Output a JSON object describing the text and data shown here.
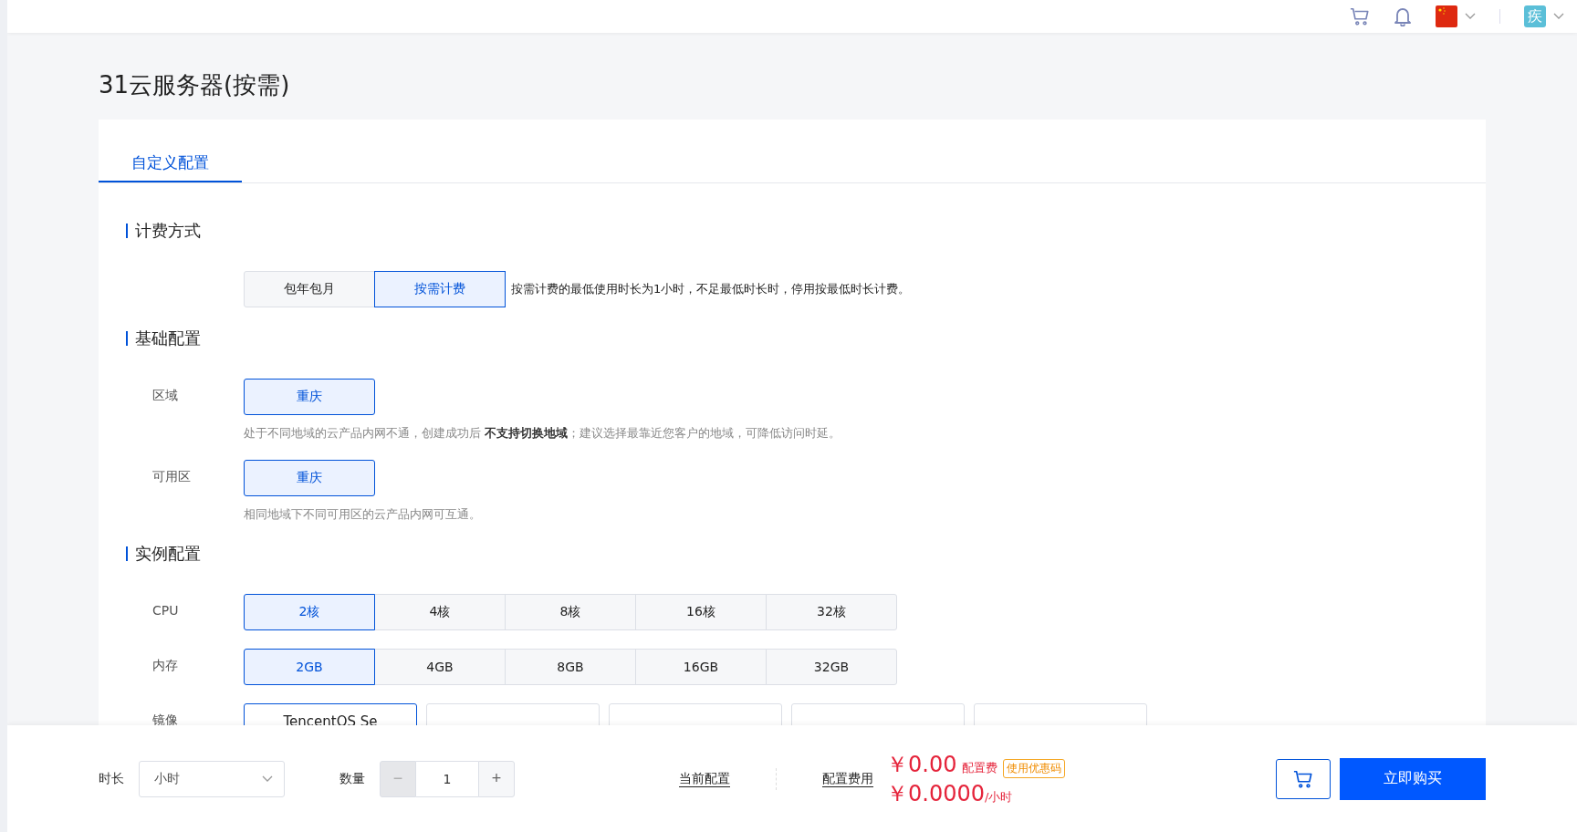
{
  "header": {
    "avatar_text": "疾"
  },
  "page_title": "31云服务器(按需)",
  "tabs": [
    {
      "label": "自定义配置",
      "selected": true
    }
  ],
  "sections": [
    {
      "heading": "计费方式",
      "fields": [
        {
          "kind": "segmented",
          "options": [
            {
              "label": "包年包月",
              "selected": false
            },
            {
              "label": "按需计费",
              "selected": true
            }
          ],
          "note": "按需计费的最低使用时长为1小时，不足最低时长时，停用按最低时长计费。"
        }
      ]
    },
    {
      "heading": "基础配置",
      "fields": [
        {
          "kind": "segmented",
          "label": "区域",
          "options": [
            {
              "label": "重庆",
              "selected": true
            }
          ],
          "hint": "处于不同地域的云产品内网不通，创建成功后 **不支持切换地域**；建议选择最靠近您客户的地域，可降低访问时延。"
        },
        {
          "kind": "segmented",
          "label": "可用区",
          "options": [
            {
              "label": "重庆",
              "selected": true
            }
          ],
          "hint": "相同地域下不同可用区的云产品内网可互通。"
        }
      ]
    },
    {
      "heading": "实例配置",
      "fields": [
        {
          "kind": "segmented",
          "label": "CPU",
          "options": [
            {
              "label": "2核",
              "selected": true
            },
            {
              "label": "4核",
              "selected": false
            },
            {
              "label": "8核",
              "selected": false
            },
            {
              "label": "16核",
              "selected": false
            },
            {
              "label": "32核",
              "selected": false
            }
          ]
        },
        {
          "kind": "segmented",
          "label": "内存",
          "options": [
            {
              "label": "2GB",
              "selected": true
            },
            {
              "label": "4GB",
              "selected": false
            },
            {
              "label": "8GB",
              "selected": false
            },
            {
              "label": "16GB",
              "selected": false
            },
            {
              "label": "32GB",
              "selected": false
            }
          ]
        },
        {
          "kind": "cards",
          "label": "镜像",
          "options": [
            {
              "label": "TencentOS Se",
              "selected": true
            },
            {
              "selected": false
            },
            {
              "selected": false
            },
            {
              "selected": false
            },
            {
              "selected": false
            }
          ]
        }
      ]
    }
  ],
  "bottom_bar": {
    "duration": {
      "label": "时长",
      "value": "小时"
    },
    "quantity": {
      "label": "数量",
      "value": "1",
      "decrement": "−",
      "increment": "+",
      "decrement_disabled": true
    },
    "current_config": "当前配置",
    "fee_label": "配置费用",
    "price": "￥0.00",
    "price_suffix": "配置费",
    "coupon": "使用优惠码",
    "hourly_price": "￥0.0000",
    "hourly_unit": "/小时",
    "buy": "立即购买"
  }
}
